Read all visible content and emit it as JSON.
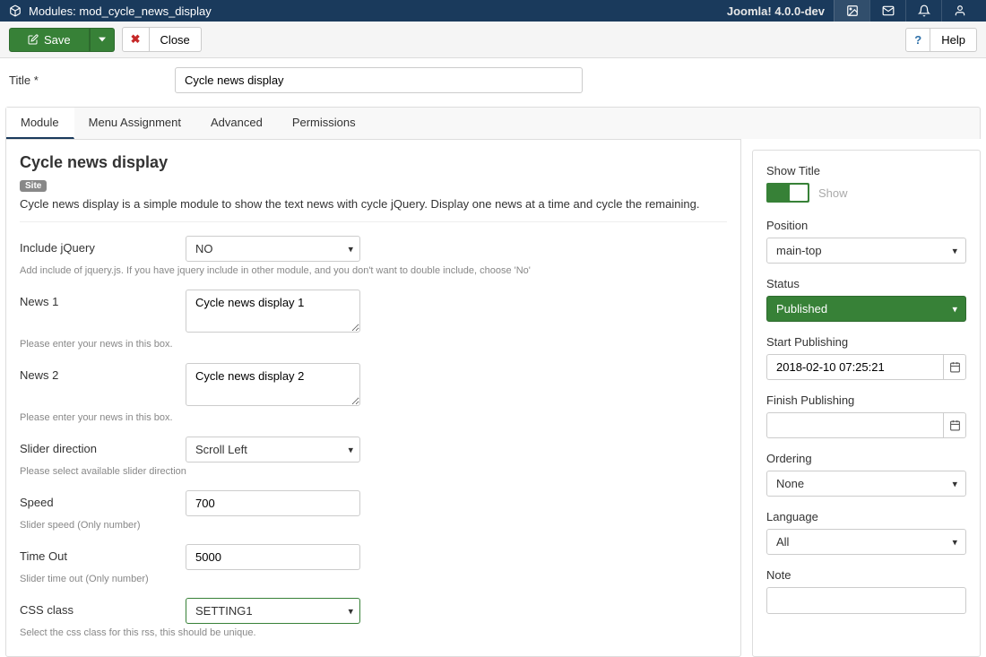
{
  "header": {
    "title": "Modules: mod_cycle_news_display",
    "version": "Joomla! 4.0.0-dev"
  },
  "toolbar": {
    "save_label": "Save",
    "close_label": "Close",
    "help_label": "Help"
  },
  "title_field": {
    "label": "Title *",
    "value": "Cycle news display"
  },
  "tabs": [
    {
      "label": "Module"
    },
    {
      "label": "Menu Assignment"
    },
    {
      "label": "Advanced"
    },
    {
      "label": "Permissions"
    }
  ],
  "module": {
    "heading": "Cycle news display",
    "badge": "Site",
    "description": "Cycle news display is a simple module to show the text news with cycle jQuery. Display one news at a time and cycle the remaining.",
    "fields": {
      "include_jquery": {
        "label": "Include jQuery",
        "value": "NO",
        "hint": "Add include of jquery.js. If you have jquery include in other module, and you don't want to double include, choose 'No'"
      },
      "news1": {
        "label": "News 1",
        "value": "Cycle news display 1",
        "hint": "Please enter your news in this box."
      },
      "news2": {
        "label": "News 2",
        "value": "Cycle news display 2",
        "hint": "Please enter your news in this box."
      },
      "slider_direction": {
        "label": "Slider direction",
        "value": "Scroll Left",
        "hint": "Please select available slider direction"
      },
      "speed": {
        "label": "Speed",
        "value": "700",
        "hint": "Slider speed (Only number)"
      },
      "timeout": {
        "label": "Time Out",
        "value": "5000",
        "hint": "Slider time out (Only number)"
      },
      "css_class": {
        "label": "CSS class",
        "value": "SETTING1",
        "hint": "Select the css class for this rss, this should be unique."
      }
    }
  },
  "sidebar": {
    "show_title": {
      "label": "Show Title",
      "state_text": "Show"
    },
    "position": {
      "label": "Position",
      "value": "main-top"
    },
    "status": {
      "label": "Status",
      "value": "Published"
    },
    "start_publishing": {
      "label": "Start Publishing",
      "value": "2018-02-10 07:25:21"
    },
    "finish_publishing": {
      "label": "Finish Publishing",
      "value": ""
    },
    "ordering": {
      "label": "Ordering",
      "value": "None"
    },
    "language": {
      "label": "Language",
      "value": "All"
    },
    "note": {
      "label": "Note",
      "value": ""
    }
  }
}
